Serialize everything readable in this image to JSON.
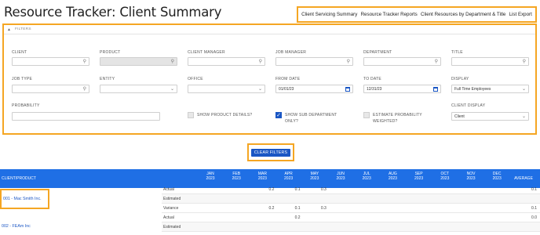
{
  "page": {
    "title": "Resource Tracker: Client Summary"
  },
  "topnav": {
    "items": [
      "Client Servicing Summary",
      "Resource Tracker Reports",
      "Client Resources by Department & Title",
      "List Export"
    ]
  },
  "filters": {
    "header": "FILTERS",
    "client": {
      "label": "CLIENT",
      "value": ""
    },
    "product": {
      "label": "PRODUCT",
      "value": ""
    },
    "client_manager": {
      "label": "CLIENT MANAGER",
      "value": ""
    },
    "job_manager": {
      "label": "JOB MANAGER",
      "value": ""
    },
    "department": {
      "label": "DEPARTMENT",
      "value": ""
    },
    "title": {
      "label": "TITLE",
      "value": ""
    },
    "job_type": {
      "label": "JOB TYPE",
      "value": ""
    },
    "entity": {
      "label": "ENTITY",
      "value": ""
    },
    "office": {
      "label": "OFFICE",
      "value": ""
    },
    "from_date": {
      "label": "FROM DATE",
      "value": "01/01/23"
    },
    "to_date": {
      "label": "TO DATE",
      "value": "12/31/23"
    },
    "display": {
      "label": "DISPLAY",
      "value": "Full Time Employees"
    },
    "probability": {
      "label": "PROBABILITY",
      "value": ""
    },
    "show_product_details": {
      "label": "SHOW PRODUCT DETAILS?",
      "checked": false
    },
    "show_sub_department": {
      "label_line1": "SHOW SUB DEPARTMENT",
      "label_line2": "ONLY?",
      "checked": true
    },
    "estimate_probability": {
      "label_line1": "ESTIMATE PROBABILITY",
      "label_line2": "WEIGHTED?",
      "checked": false
    },
    "client_display": {
      "label": "CLIENT DISPLAY",
      "value": "Client"
    }
  },
  "clear_filters": {
    "label": "CLEAR FILTERS"
  },
  "table": {
    "first_col": "CLIENT/PRODUCT",
    "months": [
      {
        "m": "JAN",
        "y": "2023"
      },
      {
        "m": "FEB",
        "y": "2023"
      },
      {
        "m": "MAR",
        "y": "2023"
      },
      {
        "m": "APR",
        "y": "2023"
      },
      {
        "m": "MAY",
        "y": "2023"
      },
      {
        "m": "JUN",
        "y": "2023"
      },
      {
        "m": "JUL",
        "y": "2023"
      },
      {
        "m": "AUG",
        "y": "2023"
      },
      {
        "m": "SEP",
        "y": "2023"
      },
      {
        "m": "OCT",
        "y": "2023"
      },
      {
        "m": "NOV",
        "y": "2023"
      },
      {
        "m": "DEC",
        "y": "2023"
      }
    ],
    "avg_col": "AVERAGE",
    "clients": [
      {
        "name": "001 - Mac Smith Inc.",
        "rows": [
          {
            "label": "Actual",
            "values": [
              "",
              "",
              "0.2",
              "0.1",
              "0.3",
              "",
              "",
              "",
              "",
              "",
              "",
              ""
            ],
            "average": "0.1"
          },
          {
            "label": "Estimated",
            "values": [
              "",
              "",
              "",
              "",
              "",
              "",
              "",
              "",
              "",
              "",
              "",
              ""
            ],
            "average": ""
          },
          {
            "label": "Variance",
            "values": [
              "",
              "",
              "0.2",
              "0.1",
              "0.3",
              "",
              "",
              "",
              "",
              "",
              "",
              ""
            ],
            "average": "0.1"
          }
        ]
      },
      {
        "name": "002 - FEAm Inc",
        "rows": [
          {
            "label": "Actual",
            "values": [
              "",
              "",
              "",
              "0.2",
              "",
              "",
              "",
              "",
              "",
              "",
              "",
              ""
            ],
            "average": "0.0"
          },
          {
            "label": "Estimated",
            "values": [
              "",
              "",
              "",
              "",
              "",
              "",
              "",
              "",
              "",
              "",
              "",
              ""
            ],
            "average": ""
          }
        ]
      }
    ]
  },
  "colors": {
    "accent": "#1a56c4",
    "header_bg": "#1f6fe5",
    "highlight": "#f5a623"
  }
}
